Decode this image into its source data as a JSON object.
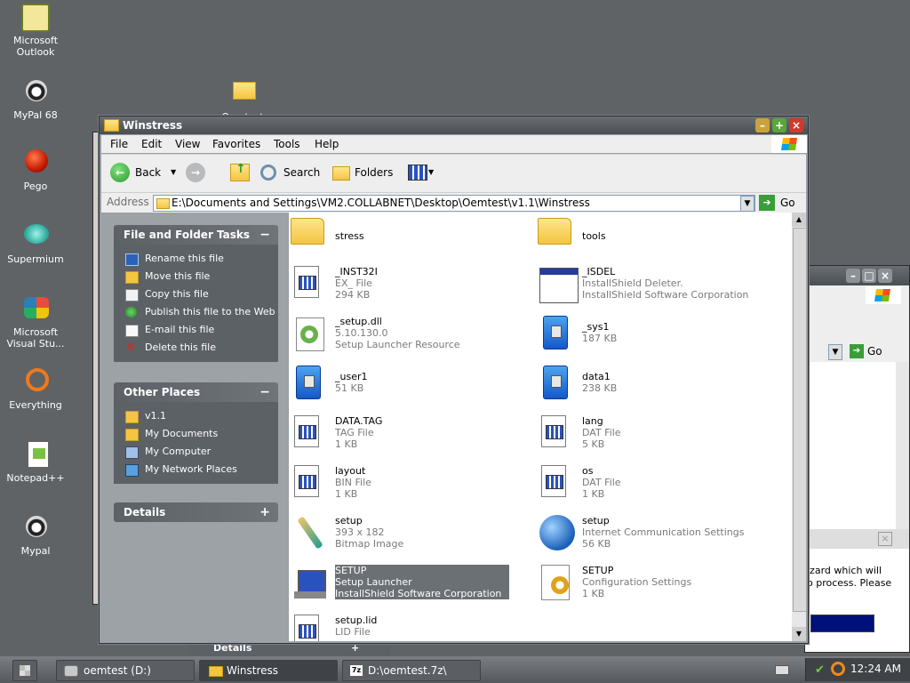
{
  "desktop_icons": [
    {
      "label": "Microsoft\nOutlook",
      "line1": "Microsoft",
      "line2": "Outlook",
      "icon": "outlook-icon"
    },
    {
      "label": "MyPal 68",
      "icon": "mypal-icon"
    },
    {
      "label": "Pego",
      "icon": "pego-icon"
    },
    {
      "label": "Supermium",
      "icon": "supermium-icon"
    },
    {
      "line1": "Microsoft",
      "line2": "Visual Stu...",
      "icon": "visual-studio-icon"
    },
    {
      "label": "Everything",
      "icon": "everything-icon"
    },
    {
      "label": "Notepad++",
      "icon": "notepadpp-icon"
    },
    {
      "label": "Mypal",
      "icon": "mypal-icon"
    }
  ],
  "desktop_folder": {
    "label": "Oemtest",
    "icon": "folder-icon"
  },
  "window": {
    "title": "Winstress",
    "menu": [
      "File",
      "Edit",
      "View",
      "Favorites",
      "Tools",
      "Help"
    ],
    "toolbar": {
      "back": "Back",
      "search": "Search",
      "folders": "Folders"
    },
    "address_label": "Address",
    "address_value": "E:\\Documents and Settings\\VM2.COLLABNET\\Desktop\\Oemtest\\v1.1\\Winstress",
    "go": "Go"
  },
  "tasks_panel": {
    "title": "File and Folder Tasks",
    "items": [
      "Rename this file",
      "Move this file",
      "Copy this file",
      "Publish this file to the Web",
      "E-mail this file",
      "Delete this file"
    ]
  },
  "places_panel": {
    "title": "Other Places",
    "items": [
      "v1.1",
      "My Documents",
      "My Computer",
      "My Network Places"
    ]
  },
  "details_panel": {
    "title": "Details"
  },
  "files": [
    {
      "name": "stress",
      "line2": "",
      "line3": "",
      "kind": "folder"
    },
    {
      "name": "tools",
      "line2": "",
      "line3": "",
      "kind": "folder"
    },
    {
      "name": "_INST32I",
      "line2": "EX_ File",
      "line3": "294 KB",
      "kind": "doc"
    },
    {
      "name": "_ISDEL",
      "line2": "InstallShield Deleter.",
      "line3": "InstallShield Software Corporation",
      "kind": "app"
    },
    {
      "name": "_setup.dll",
      "line2": "5.10.130.0",
      "line3": "Setup Launcher Resource",
      "kind": "dll"
    },
    {
      "name": "_sys1",
      "line2": "187 KB",
      "line3": "",
      "kind": "cabinet"
    },
    {
      "name": "_user1",
      "line2": "51 KB",
      "line3": "",
      "kind": "cabinet"
    },
    {
      "name": "data1",
      "line2": "238 KB",
      "line3": "",
      "kind": "cabinet"
    },
    {
      "name": "DATA.TAG",
      "line2": "TAG File",
      "line3": "1 KB",
      "kind": "doc"
    },
    {
      "name": "lang",
      "line2": "DAT File",
      "line3": "5 KB",
      "kind": "doc"
    },
    {
      "name": "layout",
      "line2": "BIN File",
      "line3": "1 KB",
      "kind": "doc"
    },
    {
      "name": "os",
      "line2": "DAT File",
      "line3": "1 KB",
      "kind": "doc"
    },
    {
      "name": "setup",
      "line2": "393 x 182",
      "line3": "Bitmap Image",
      "kind": "bitmap"
    },
    {
      "name": "setup",
      "line2": "Internet Communication Settings",
      "line3": "56 KB",
      "kind": "ini"
    },
    {
      "name": "SETUP",
      "line2": "Setup Launcher",
      "line3": "InstallShield Software Corporation",
      "kind": "setup",
      "selected": true
    },
    {
      "name": "SETUP",
      "line2": "Configuration Settings",
      "line3": "1 KB",
      "kind": "config"
    },
    {
      "name": "setup.lid",
      "line2": "LID File",
      "line3": "",
      "kind": "doc"
    }
  ],
  "background_window": {
    "go": "Go",
    "dialog_text_1": "izard which will",
    "dialog_text_2": "o process.  Please"
  },
  "background_details": "Details",
  "taskbar": {
    "tasks": [
      "oemtest (D:)",
      "Winstress",
      "D:\\oemtest.7z\\"
    ],
    "clock": "12:24 AM"
  },
  "colors": {
    "accent": "#4b4f53",
    "selection": "#6b7075",
    "panel": "#5c6166"
  }
}
